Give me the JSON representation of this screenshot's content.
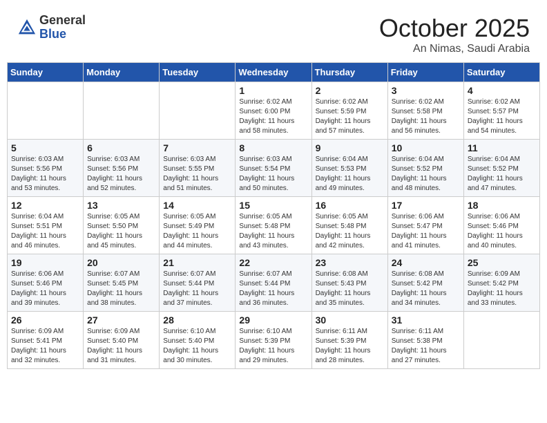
{
  "header": {
    "logo_general": "General",
    "logo_blue": "Blue",
    "month_title": "October 2025",
    "location": "An Nimas, Saudi Arabia"
  },
  "weekdays": [
    "Sunday",
    "Monday",
    "Tuesday",
    "Wednesday",
    "Thursday",
    "Friday",
    "Saturday"
  ],
  "weeks": [
    [
      {
        "day": "",
        "sunrise": "",
        "sunset": "",
        "daylight": ""
      },
      {
        "day": "",
        "sunrise": "",
        "sunset": "",
        "daylight": ""
      },
      {
        "day": "",
        "sunrise": "",
        "sunset": "",
        "daylight": ""
      },
      {
        "day": "1",
        "sunrise": "Sunrise: 6:02 AM",
        "sunset": "Sunset: 6:00 PM",
        "daylight": "Daylight: 11 hours and 58 minutes."
      },
      {
        "day": "2",
        "sunrise": "Sunrise: 6:02 AM",
        "sunset": "Sunset: 5:59 PM",
        "daylight": "Daylight: 11 hours and 57 minutes."
      },
      {
        "day": "3",
        "sunrise": "Sunrise: 6:02 AM",
        "sunset": "Sunset: 5:58 PM",
        "daylight": "Daylight: 11 hours and 56 minutes."
      },
      {
        "day": "4",
        "sunrise": "Sunrise: 6:02 AM",
        "sunset": "Sunset: 5:57 PM",
        "daylight": "Daylight: 11 hours and 54 minutes."
      }
    ],
    [
      {
        "day": "5",
        "sunrise": "Sunrise: 6:03 AM",
        "sunset": "Sunset: 5:56 PM",
        "daylight": "Daylight: 11 hours and 53 minutes."
      },
      {
        "day": "6",
        "sunrise": "Sunrise: 6:03 AM",
        "sunset": "Sunset: 5:56 PM",
        "daylight": "Daylight: 11 hours and 52 minutes."
      },
      {
        "day": "7",
        "sunrise": "Sunrise: 6:03 AM",
        "sunset": "Sunset: 5:55 PM",
        "daylight": "Daylight: 11 hours and 51 minutes."
      },
      {
        "day": "8",
        "sunrise": "Sunrise: 6:03 AM",
        "sunset": "Sunset: 5:54 PM",
        "daylight": "Daylight: 11 hours and 50 minutes."
      },
      {
        "day": "9",
        "sunrise": "Sunrise: 6:04 AM",
        "sunset": "Sunset: 5:53 PM",
        "daylight": "Daylight: 11 hours and 49 minutes."
      },
      {
        "day": "10",
        "sunrise": "Sunrise: 6:04 AM",
        "sunset": "Sunset: 5:52 PM",
        "daylight": "Daylight: 11 hours and 48 minutes."
      },
      {
        "day": "11",
        "sunrise": "Sunrise: 6:04 AM",
        "sunset": "Sunset: 5:52 PM",
        "daylight": "Daylight: 11 hours and 47 minutes."
      }
    ],
    [
      {
        "day": "12",
        "sunrise": "Sunrise: 6:04 AM",
        "sunset": "Sunset: 5:51 PM",
        "daylight": "Daylight: 11 hours and 46 minutes."
      },
      {
        "day": "13",
        "sunrise": "Sunrise: 6:05 AM",
        "sunset": "Sunset: 5:50 PM",
        "daylight": "Daylight: 11 hours and 45 minutes."
      },
      {
        "day": "14",
        "sunrise": "Sunrise: 6:05 AM",
        "sunset": "Sunset: 5:49 PM",
        "daylight": "Daylight: 11 hours and 44 minutes."
      },
      {
        "day": "15",
        "sunrise": "Sunrise: 6:05 AM",
        "sunset": "Sunset: 5:48 PM",
        "daylight": "Daylight: 11 hours and 43 minutes."
      },
      {
        "day": "16",
        "sunrise": "Sunrise: 6:05 AM",
        "sunset": "Sunset: 5:48 PM",
        "daylight": "Daylight: 11 hours and 42 minutes."
      },
      {
        "day": "17",
        "sunrise": "Sunrise: 6:06 AM",
        "sunset": "Sunset: 5:47 PM",
        "daylight": "Daylight: 11 hours and 41 minutes."
      },
      {
        "day": "18",
        "sunrise": "Sunrise: 6:06 AM",
        "sunset": "Sunset: 5:46 PM",
        "daylight": "Daylight: 11 hours and 40 minutes."
      }
    ],
    [
      {
        "day": "19",
        "sunrise": "Sunrise: 6:06 AM",
        "sunset": "Sunset: 5:46 PM",
        "daylight": "Daylight: 11 hours and 39 minutes."
      },
      {
        "day": "20",
        "sunrise": "Sunrise: 6:07 AM",
        "sunset": "Sunset: 5:45 PM",
        "daylight": "Daylight: 11 hours and 38 minutes."
      },
      {
        "day": "21",
        "sunrise": "Sunrise: 6:07 AM",
        "sunset": "Sunset: 5:44 PM",
        "daylight": "Daylight: 11 hours and 37 minutes."
      },
      {
        "day": "22",
        "sunrise": "Sunrise: 6:07 AM",
        "sunset": "Sunset: 5:44 PM",
        "daylight": "Daylight: 11 hours and 36 minutes."
      },
      {
        "day": "23",
        "sunrise": "Sunrise: 6:08 AM",
        "sunset": "Sunset: 5:43 PM",
        "daylight": "Daylight: 11 hours and 35 minutes."
      },
      {
        "day": "24",
        "sunrise": "Sunrise: 6:08 AM",
        "sunset": "Sunset: 5:42 PM",
        "daylight": "Daylight: 11 hours and 34 minutes."
      },
      {
        "day": "25",
        "sunrise": "Sunrise: 6:09 AM",
        "sunset": "Sunset: 5:42 PM",
        "daylight": "Daylight: 11 hours and 33 minutes."
      }
    ],
    [
      {
        "day": "26",
        "sunrise": "Sunrise: 6:09 AM",
        "sunset": "Sunset: 5:41 PM",
        "daylight": "Daylight: 11 hours and 32 minutes."
      },
      {
        "day": "27",
        "sunrise": "Sunrise: 6:09 AM",
        "sunset": "Sunset: 5:40 PM",
        "daylight": "Daylight: 11 hours and 31 minutes."
      },
      {
        "day": "28",
        "sunrise": "Sunrise: 6:10 AM",
        "sunset": "Sunset: 5:40 PM",
        "daylight": "Daylight: 11 hours and 30 minutes."
      },
      {
        "day": "29",
        "sunrise": "Sunrise: 6:10 AM",
        "sunset": "Sunset: 5:39 PM",
        "daylight": "Daylight: 11 hours and 29 minutes."
      },
      {
        "day": "30",
        "sunrise": "Sunrise: 6:11 AM",
        "sunset": "Sunset: 5:39 PM",
        "daylight": "Daylight: 11 hours and 28 minutes."
      },
      {
        "day": "31",
        "sunrise": "Sunrise: 6:11 AM",
        "sunset": "Sunset: 5:38 PM",
        "daylight": "Daylight: 11 hours and 27 minutes."
      },
      {
        "day": "",
        "sunrise": "",
        "sunset": "",
        "daylight": ""
      }
    ]
  ]
}
